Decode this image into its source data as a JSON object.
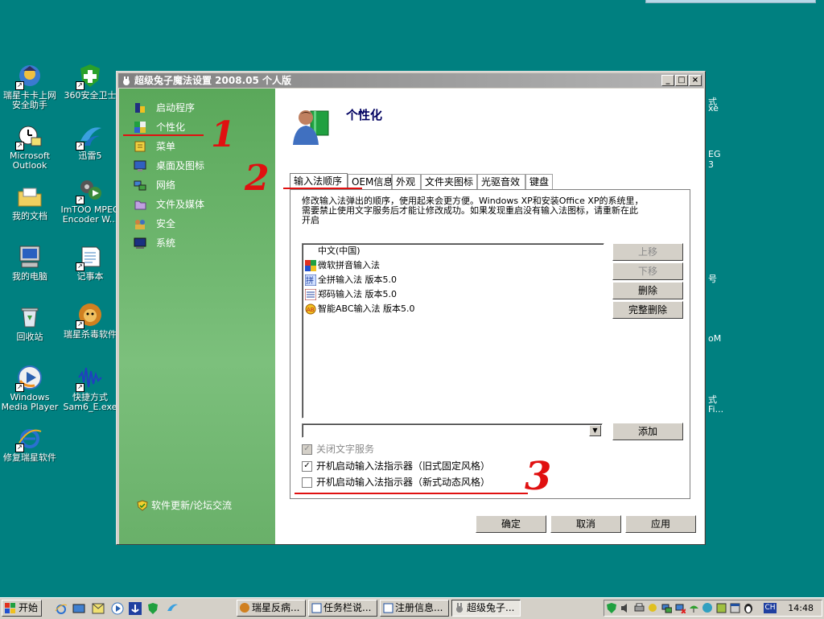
{
  "desktop": {
    "icons": [
      {
        "label": "瑞星卡卡上网安全助手"
      },
      {
        "label": "360安全卫士"
      },
      {
        "label": "Microsoft Outlook"
      },
      {
        "label": "迅雷5"
      },
      {
        "label": "我的文档"
      },
      {
        "label": "ImTOO MPEG Encoder W..."
      },
      {
        "label": "我的电脑"
      },
      {
        "label": "记事本"
      },
      {
        "label": "回收站"
      },
      {
        "label": "瑞星杀毒软件"
      },
      {
        "label": "Windows Media Player"
      },
      {
        "label": "快捷方式 Sam6_E.exe"
      },
      {
        "label": "修复瑞星软件"
      }
    ],
    "right_edge_fragments": [
      "式",
      "xe",
      "EG",
      "3",
      "号",
      "oM",
      "式",
      "Fi..."
    ]
  },
  "window": {
    "title": "超级兔子魔法设置 2008.05 个人版",
    "nav": {
      "items": [
        {
          "label": "启动程序"
        },
        {
          "label": "个性化"
        },
        {
          "label": "菜单"
        },
        {
          "label": "桌面及图标"
        },
        {
          "label": "网络"
        },
        {
          "label": "文件及媒体"
        },
        {
          "label": "安全"
        },
        {
          "label": "系统"
        }
      ],
      "selected": "个性化",
      "footer_link": "软件更新/论坛交流"
    },
    "header": {
      "title": "个性化"
    },
    "tabs": [
      {
        "label": "输入法顺序"
      },
      {
        "label": "OEM信息"
      },
      {
        "label": "外观"
      },
      {
        "label": "文件夹图标"
      },
      {
        "label": "光驱音效"
      },
      {
        "label": "键盘"
      }
    ],
    "active_tab": "输入法顺序",
    "panel": {
      "description": "修改输入法弹出的顺序，使用起来会更方便。Windows XP和安装Office XP的系统里，需要禁止使用文字服务后才能让修改成功。如果发现重启没有输入法图标，请重新在此开启",
      "ime_list": [
        {
          "label": "中文(中国)"
        },
        {
          "label": "微软拼音输入法"
        },
        {
          "label": "全拼输入法 版本5.0"
        },
        {
          "label": "郑码输入法 版本5.0"
        },
        {
          "label": "智能ABC输入法 版本5.0"
        }
      ],
      "buttons": {
        "move_up": "上移",
        "move_down": "下移",
        "delete": "删除",
        "delete_all": "完整删除",
        "add": "添加"
      },
      "combo_value": "",
      "checkboxes": [
        {
          "label": "关闭文字服务",
          "checked": true,
          "disabled": true
        },
        {
          "label": "开机启动输入法指示器（旧式固定风格）",
          "checked": true,
          "disabled": false
        },
        {
          "label": "开机启动输入法指示器（新式动态风格）",
          "checked": false,
          "disabled": false
        }
      ]
    },
    "footer_buttons": {
      "ok": "确定",
      "cancel": "取消",
      "apply": "应用"
    }
  },
  "annotations": [
    "1",
    "2",
    "3"
  ],
  "taskbar": {
    "start_label": "开始",
    "tasks": [
      {
        "label": "瑞星反病..."
      },
      {
        "label": "任务栏说..."
      },
      {
        "label": "注册信息..."
      },
      {
        "label": "超级兔子..."
      }
    ],
    "lang": "CH",
    "clock": "14:48"
  }
}
